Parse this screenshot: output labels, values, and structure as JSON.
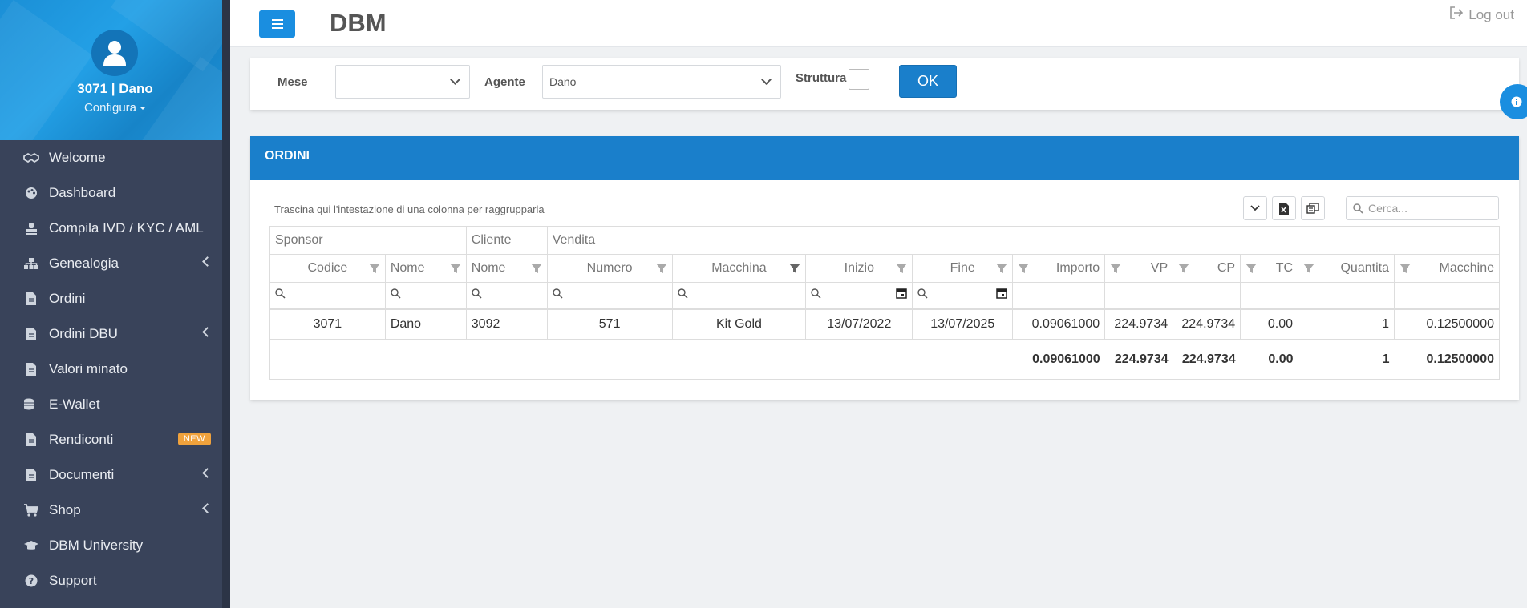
{
  "sidebar": {
    "user_name": "3071 | Dano",
    "config_label": "Configura",
    "items": [
      {
        "label": "Welcome",
        "icon": "handshake-icon"
      },
      {
        "label": "Dashboard",
        "icon": "palette-icon"
      },
      {
        "label": "Compila IVD / KYC / AML",
        "icon": "stamp-icon"
      },
      {
        "label": "Genealogia",
        "icon": "sitemap-icon",
        "has_submenu": true
      },
      {
        "label": "Ordini",
        "icon": "file-icon"
      },
      {
        "label": "Ordini DBU",
        "icon": "file-icon",
        "has_submenu": true
      },
      {
        "label": "Valori minato",
        "icon": "file-icon"
      },
      {
        "label": "E-Wallet",
        "icon": "coins-icon"
      },
      {
        "label": "Rendiconti",
        "icon": "file-icon",
        "badge": "NEW"
      },
      {
        "label": "Documenti",
        "icon": "file-icon",
        "has_submenu": true
      },
      {
        "label": "Shop",
        "icon": "cart-icon",
        "has_submenu": true
      },
      {
        "label": "DBM University",
        "icon": "graduation-cap-icon"
      },
      {
        "label": "Support",
        "icon": "question-circle-icon"
      }
    ]
  },
  "header": {
    "title": "DBM",
    "logout_label": "Log out"
  },
  "filters": {
    "month_label": "Mese",
    "month_value": "",
    "agent_label": "Agente",
    "agent_value": "Dano",
    "structure_label": "Struttura",
    "ok_label": "OK"
  },
  "orders": {
    "title": "ORDINI",
    "group_hint": "Trascina qui l'intestazione di una colonna per raggrupparla",
    "search_placeholder": "Cerca...",
    "bands": {
      "sponsor": "Sponsor",
      "cliente": "Cliente",
      "vendita": "Vendita"
    },
    "columns": {
      "codice": "Codice",
      "nome_sponsor": "Nome",
      "nome_cliente": "Nome",
      "numero": "Numero",
      "macchina": "Macchina",
      "inizio": "Inizio",
      "fine": "Fine",
      "importo": "Importo",
      "vp": "VP",
      "cp": "CP",
      "tc": "TC",
      "quantita": "Quantita",
      "macchine": "Macchine"
    },
    "rows": [
      {
        "codice": "3071",
        "nome_sponsor": "Dano",
        "nome_cliente": "3092",
        "numero": "571",
        "macchina": "Kit Gold",
        "inizio": "13/07/2022",
        "fine": "13/07/2025",
        "importo": "0.09061000",
        "vp": "224.9734",
        "cp": "224.9734",
        "tc": "0.00",
        "quantita": "1",
        "macchine": "0.12500000"
      }
    ],
    "totals": {
      "importo": "0.09061000",
      "vp": "224.9734",
      "cp": "224.9734",
      "tc": "0.00",
      "quantita": "1",
      "macchine": "0.12500000"
    }
  },
  "colors": {
    "accent": "#1a7fcb",
    "sidebar_bg": "#39435a",
    "badge_new": "#f0a23c"
  }
}
